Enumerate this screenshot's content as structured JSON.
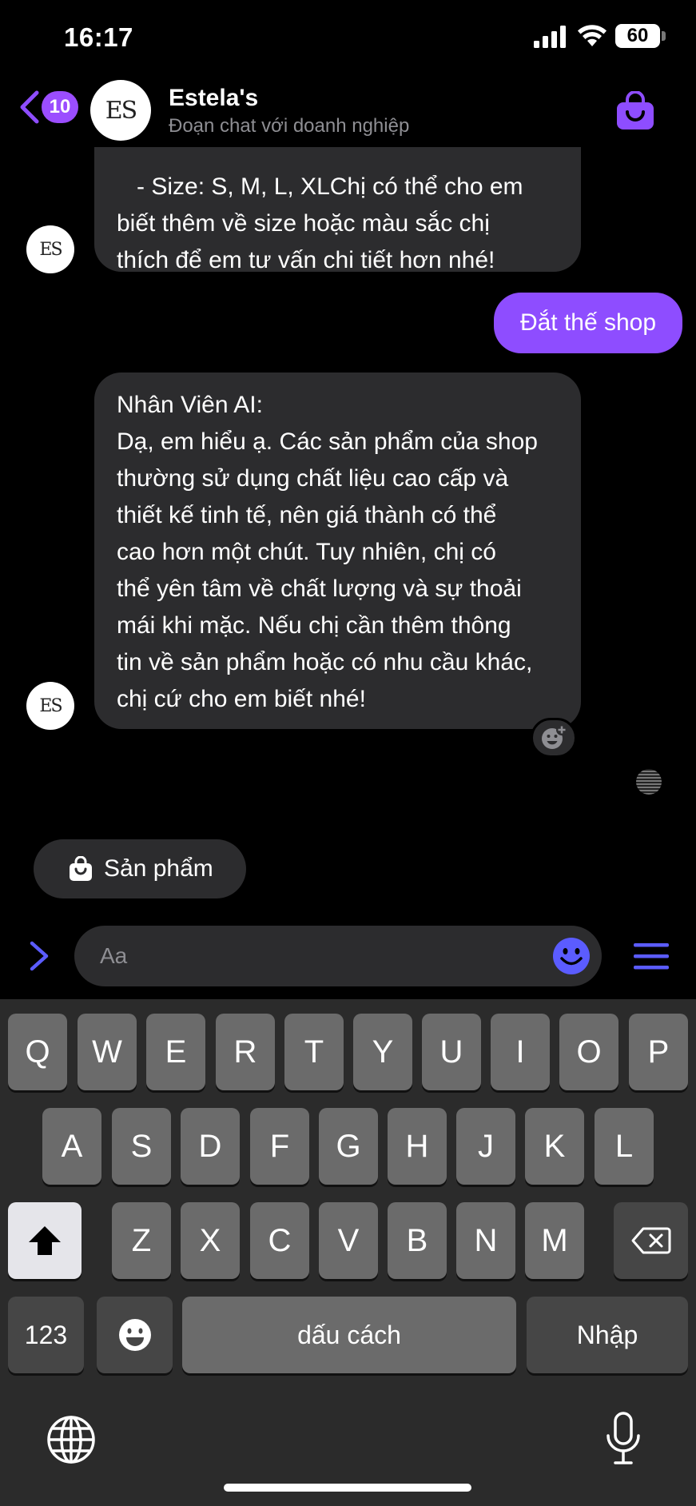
{
  "status_bar": {
    "time": "16:17",
    "battery": "60"
  },
  "header": {
    "unread_count": "10",
    "avatar_logo": "ES",
    "title": "Estela's",
    "subtitle": "Đoạn chat với doanh nghiệp",
    "shop_icon": "shopping-bag-icon"
  },
  "messages": [
    {
      "direction": "incoming",
      "lines": [
        "   - Size: S, M, L, XLChị có thể cho em",
        "biết thêm về size hoặc màu sắc chị",
        "thích để em tư vấn chi tiết hơn nhé!"
      ]
    },
    {
      "direction": "outgoing",
      "lines": [
        "Đắt thế shop"
      ]
    },
    {
      "direction": "incoming",
      "lines": [
        "Nhân Viên AI:",
        "Dạ, em hiểu ạ. Các sản phẩm của shop",
        "thường sử dụng chất liệu cao cấp và",
        "thiết kế tinh tế, nên giá thành có thể",
        "cao hơn một chút. Tuy nhiên, chị có",
        "thể yên tâm về chất lượng và sự thoải",
        "mái khi mặc. Nếu chị cần thêm thông",
        "tin về sản phẩm hoặc có nhu cầu khác,",
        "chị cứ cho em biết nhé!"
      ]
    }
  ],
  "quick_reply": {
    "label": "Sản phẩm",
    "icon": "shopping-bag-icon"
  },
  "composer": {
    "placeholder": "Aa"
  },
  "keyboard": {
    "row1": [
      "Q",
      "W",
      "E",
      "R",
      "T",
      "Y",
      "U",
      "I",
      "O",
      "P"
    ],
    "row2": [
      "A",
      "S",
      "D",
      "F",
      "G",
      "H",
      "J",
      "K",
      "L"
    ],
    "row3": [
      "Z",
      "X",
      "C",
      "V",
      "B",
      "N",
      "M"
    ],
    "numbers_label": "123",
    "space_label": "dấu cách",
    "return_label": "Nhập"
  },
  "colors": {
    "accent": "#8e4dff",
    "bubble_incoming": "#2c2c2e",
    "composer_icons": "#5b5cff"
  }
}
